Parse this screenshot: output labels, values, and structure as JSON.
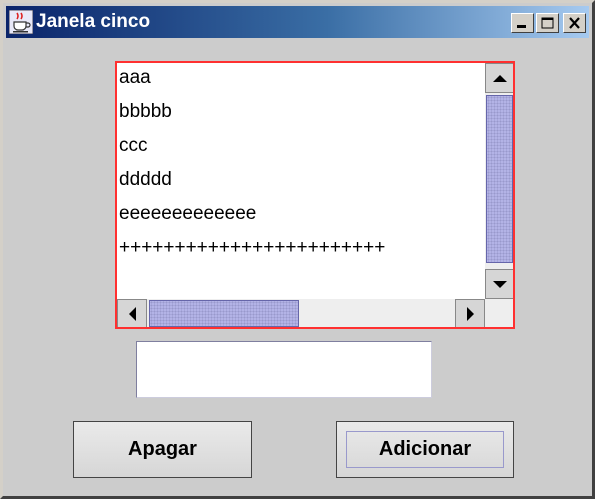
{
  "window": {
    "title": "Janela cinco",
    "icon": "java-cup-icon",
    "controls": [
      "minimize",
      "maximize",
      "close"
    ]
  },
  "list": {
    "items": [
      "aaa",
      "bbbbb",
      "ccc",
      "ddddd",
      "eeeeeeeeeeeee",
      "++++++++++++++++++++++++"
    ],
    "border_color": "#ff3030"
  },
  "text_field": {
    "value": ""
  },
  "buttons": {
    "apagar": "Apagar",
    "adicionar": "Adicionar"
  }
}
